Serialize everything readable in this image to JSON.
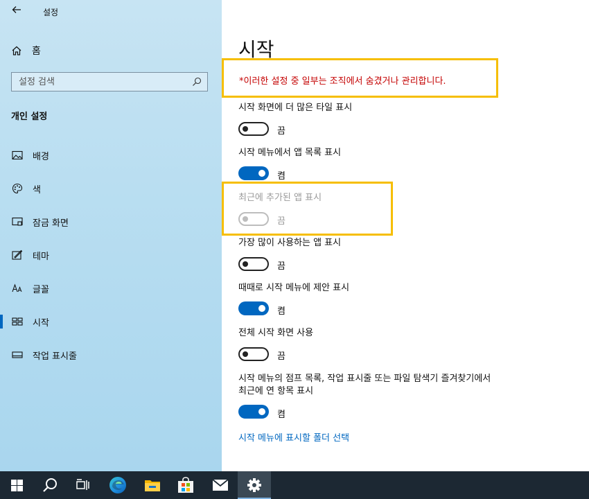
{
  "app": {
    "title": "설정"
  },
  "sidebar": {
    "home_label": "홈",
    "search_placeholder": "설정 검색",
    "section_title": "개인 설정",
    "items": [
      {
        "label": "배경",
        "icon": "image-icon"
      },
      {
        "label": "색",
        "icon": "palette-icon"
      },
      {
        "label": "잠금 화면",
        "icon": "lock-screen-icon"
      },
      {
        "label": "테마",
        "icon": "theme-icon"
      },
      {
        "label": "글꼴",
        "icon": "font-icon"
      },
      {
        "label": "시작",
        "icon": "start-icon",
        "active": true
      },
      {
        "label": "작업 표시줄",
        "icon": "taskbar-icon"
      }
    ]
  },
  "main": {
    "title": "시작",
    "notice": "*이러한 설정 중 일부는 조직에서 숨겼거나 관리합니다.",
    "settings": [
      {
        "label": "시작 화면에 더 많은 타일 표시",
        "state": "끔",
        "on": false,
        "disabled": false
      },
      {
        "label": "시작 메뉴에서 앱 목록 표시",
        "state": "켬",
        "on": true,
        "disabled": false
      },
      {
        "label": "최근에 추가된 앱 표시",
        "state": "끔",
        "on": false,
        "disabled": true
      },
      {
        "label": "가장 많이 사용하는 앱 표시",
        "state": "끔",
        "on": false,
        "disabled": false
      },
      {
        "label": "때때로 시작 메뉴에 제안 표시",
        "state": "켬",
        "on": true,
        "disabled": false
      },
      {
        "label": "전체 시작 화면 사용",
        "state": "끔",
        "on": false,
        "disabled": false
      },
      {
        "label_line1": "시작 메뉴의 점프 목록, 작업 표시줄 또는 파일 탐색기 즐겨찾기에서",
        "label_line2": "최근에 연 항목 표시",
        "state": "켬",
        "on": true,
        "disabled": false
      }
    ],
    "folder_link": "시작 메뉴에 표시할 폴더 선택"
  },
  "colors": {
    "accent": "#0067c0",
    "notice_text": "#c40000",
    "highlight_border": "#f6be00",
    "taskbar": "#1c2833"
  },
  "taskbar": {
    "items": [
      "windows-start-icon",
      "search-icon",
      "task-view-icon",
      "edge-icon",
      "file-explorer-icon",
      "store-icon",
      "mail-icon",
      "settings-gear-icon"
    ],
    "active": "settings-gear-icon"
  }
}
